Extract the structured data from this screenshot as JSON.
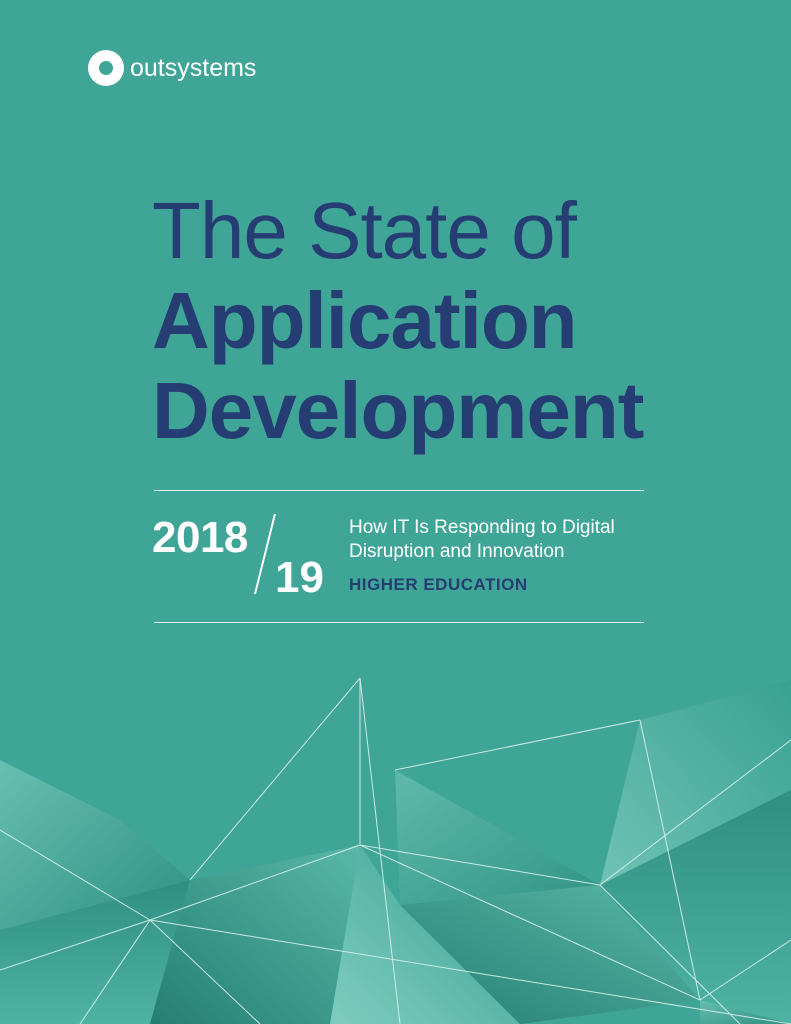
{
  "brand": {
    "logo_text": "outsystems"
  },
  "title": {
    "line1": "The State of",
    "line2": "Application",
    "line3": "Development"
  },
  "edition": {
    "year_main": "2018",
    "year_sub": "19"
  },
  "subtitle": {
    "line1": "How IT Is Responding to Digital",
    "line2": "Disruption and Innovation",
    "sector": "HIGHER EDUCATION"
  },
  "colors": {
    "background": "#3fa596",
    "title": "#253d73",
    "text_light": "#ffffff"
  }
}
